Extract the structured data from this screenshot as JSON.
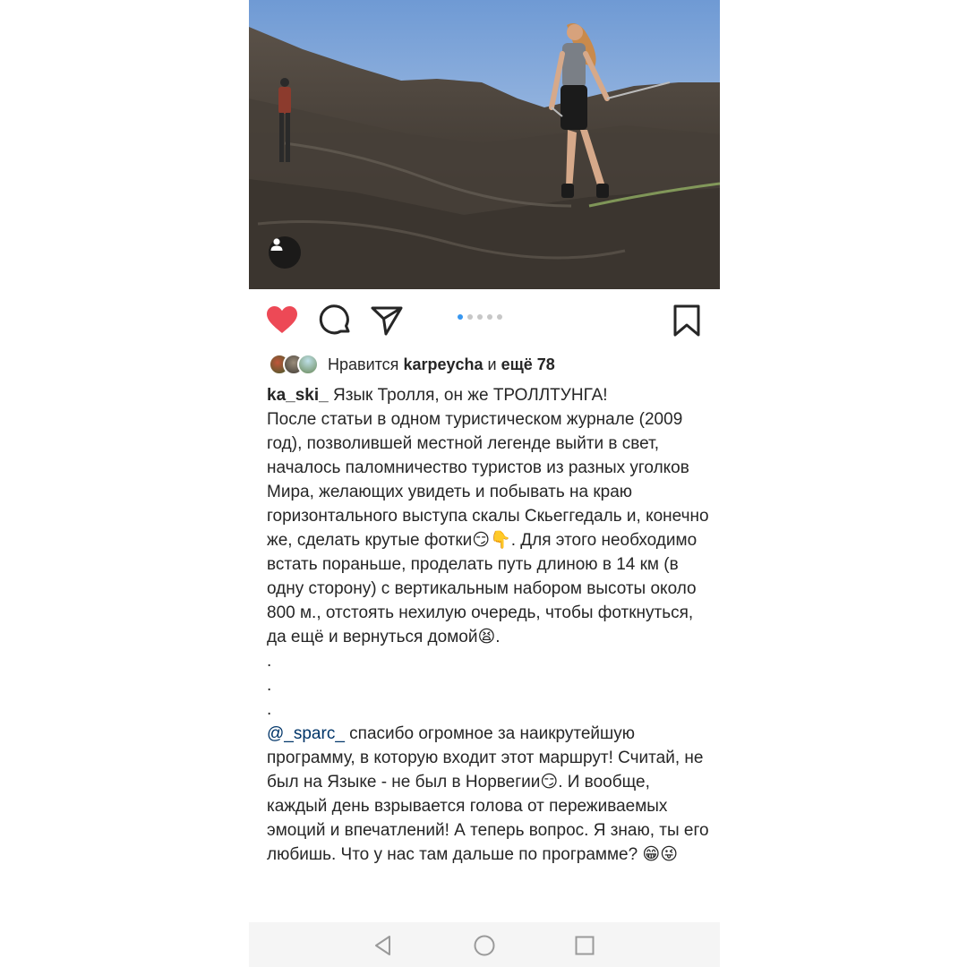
{
  "post": {
    "photo": {
      "alt_icon": "user-tag-icon",
      "carousel": {
        "count": 5,
        "active_index": 0
      }
    },
    "actions": {
      "like_icon": "heart-filled-icon",
      "comment_icon": "comment-bubble-icon",
      "share_icon": "paper-plane-icon",
      "save_icon": "bookmark-icon",
      "like_color": "#ed4956"
    },
    "likes": {
      "prefix": "Нравится ",
      "user": "karpeycha",
      "middle": " и ",
      "rest": "ещё 78"
    },
    "caption": {
      "username": "ka_ski_",
      "text1": " Язык Тролля, он же ТРОЛЛТУНГА!\nПосле статьи в одном туристическом журнале (2009 год), позволившей местной легенде выйти в свет, началось паломничество туристов из разных уголков Мира,  желающих увидеть и побывать на краю горизонтального выступа скалы Скьеггедаль и, конечно же, сделать крутые фотки😏👇. Для этого необходимо встать пораньше, проделать путь  длиною в 14 км (в одну сторону)  с вертикальным набором  высоты около 800 м., отстоять нехилую очередь, чтобы фоткнуться, да ещё и вернуться домой😫.\n.\n.\n.",
      "mention": "@_sparc_",
      "text2": " спасибо огромное за наикрутейшую программу, в которую входит этот маршрут! Считай, не был на Языке - не был в Норвегии😏. И вообще, каждый день взрывается голова от переживаемых эмоций и впечатлений! А теперь вопрос. Я знаю, ты его любишь. Что у нас там дальше по программе? 😁😜"
    }
  },
  "navbar": {
    "back_icon": "triangle-back-icon",
    "home_icon": "circle-home-icon",
    "recents_icon": "square-recents-icon"
  }
}
